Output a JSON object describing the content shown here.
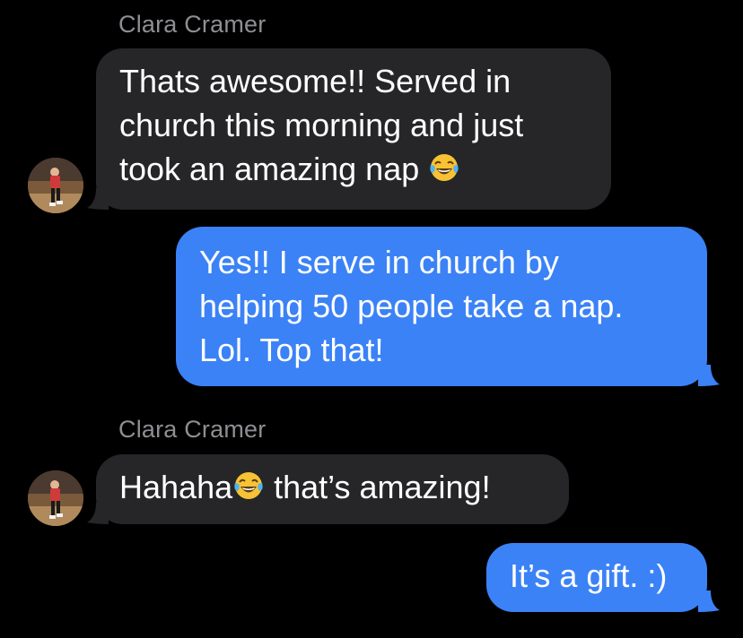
{
  "conversation": {
    "messages": [
      {
        "direction": "incoming",
        "sender": "Clara Cramer",
        "lines": [
          "Thats awesome!! Served in",
          "church this morning and just",
          "took an amazing nap"
        ],
        "emoji": "face-with-tears-of-joy"
      },
      {
        "direction": "outgoing",
        "text": "Yes!! I serve in church by\nhelping 50 people take a nap.\nLol. Top that!"
      },
      {
        "direction": "incoming",
        "sender": "Clara Cramer",
        "text_before_emoji": "Hahaha",
        "emoji": "face-with-tears-of-joy",
        "text_after_emoji": " that’s amazing!"
      },
      {
        "direction": "outgoing",
        "text": "It’s a gift. :)"
      }
    ]
  },
  "colors": {
    "background": "#000000",
    "incoming_bubble": "#262628",
    "outgoing_bubble": "#3b82f6",
    "sender_name": "#8e8e93",
    "text": "#ffffff"
  }
}
